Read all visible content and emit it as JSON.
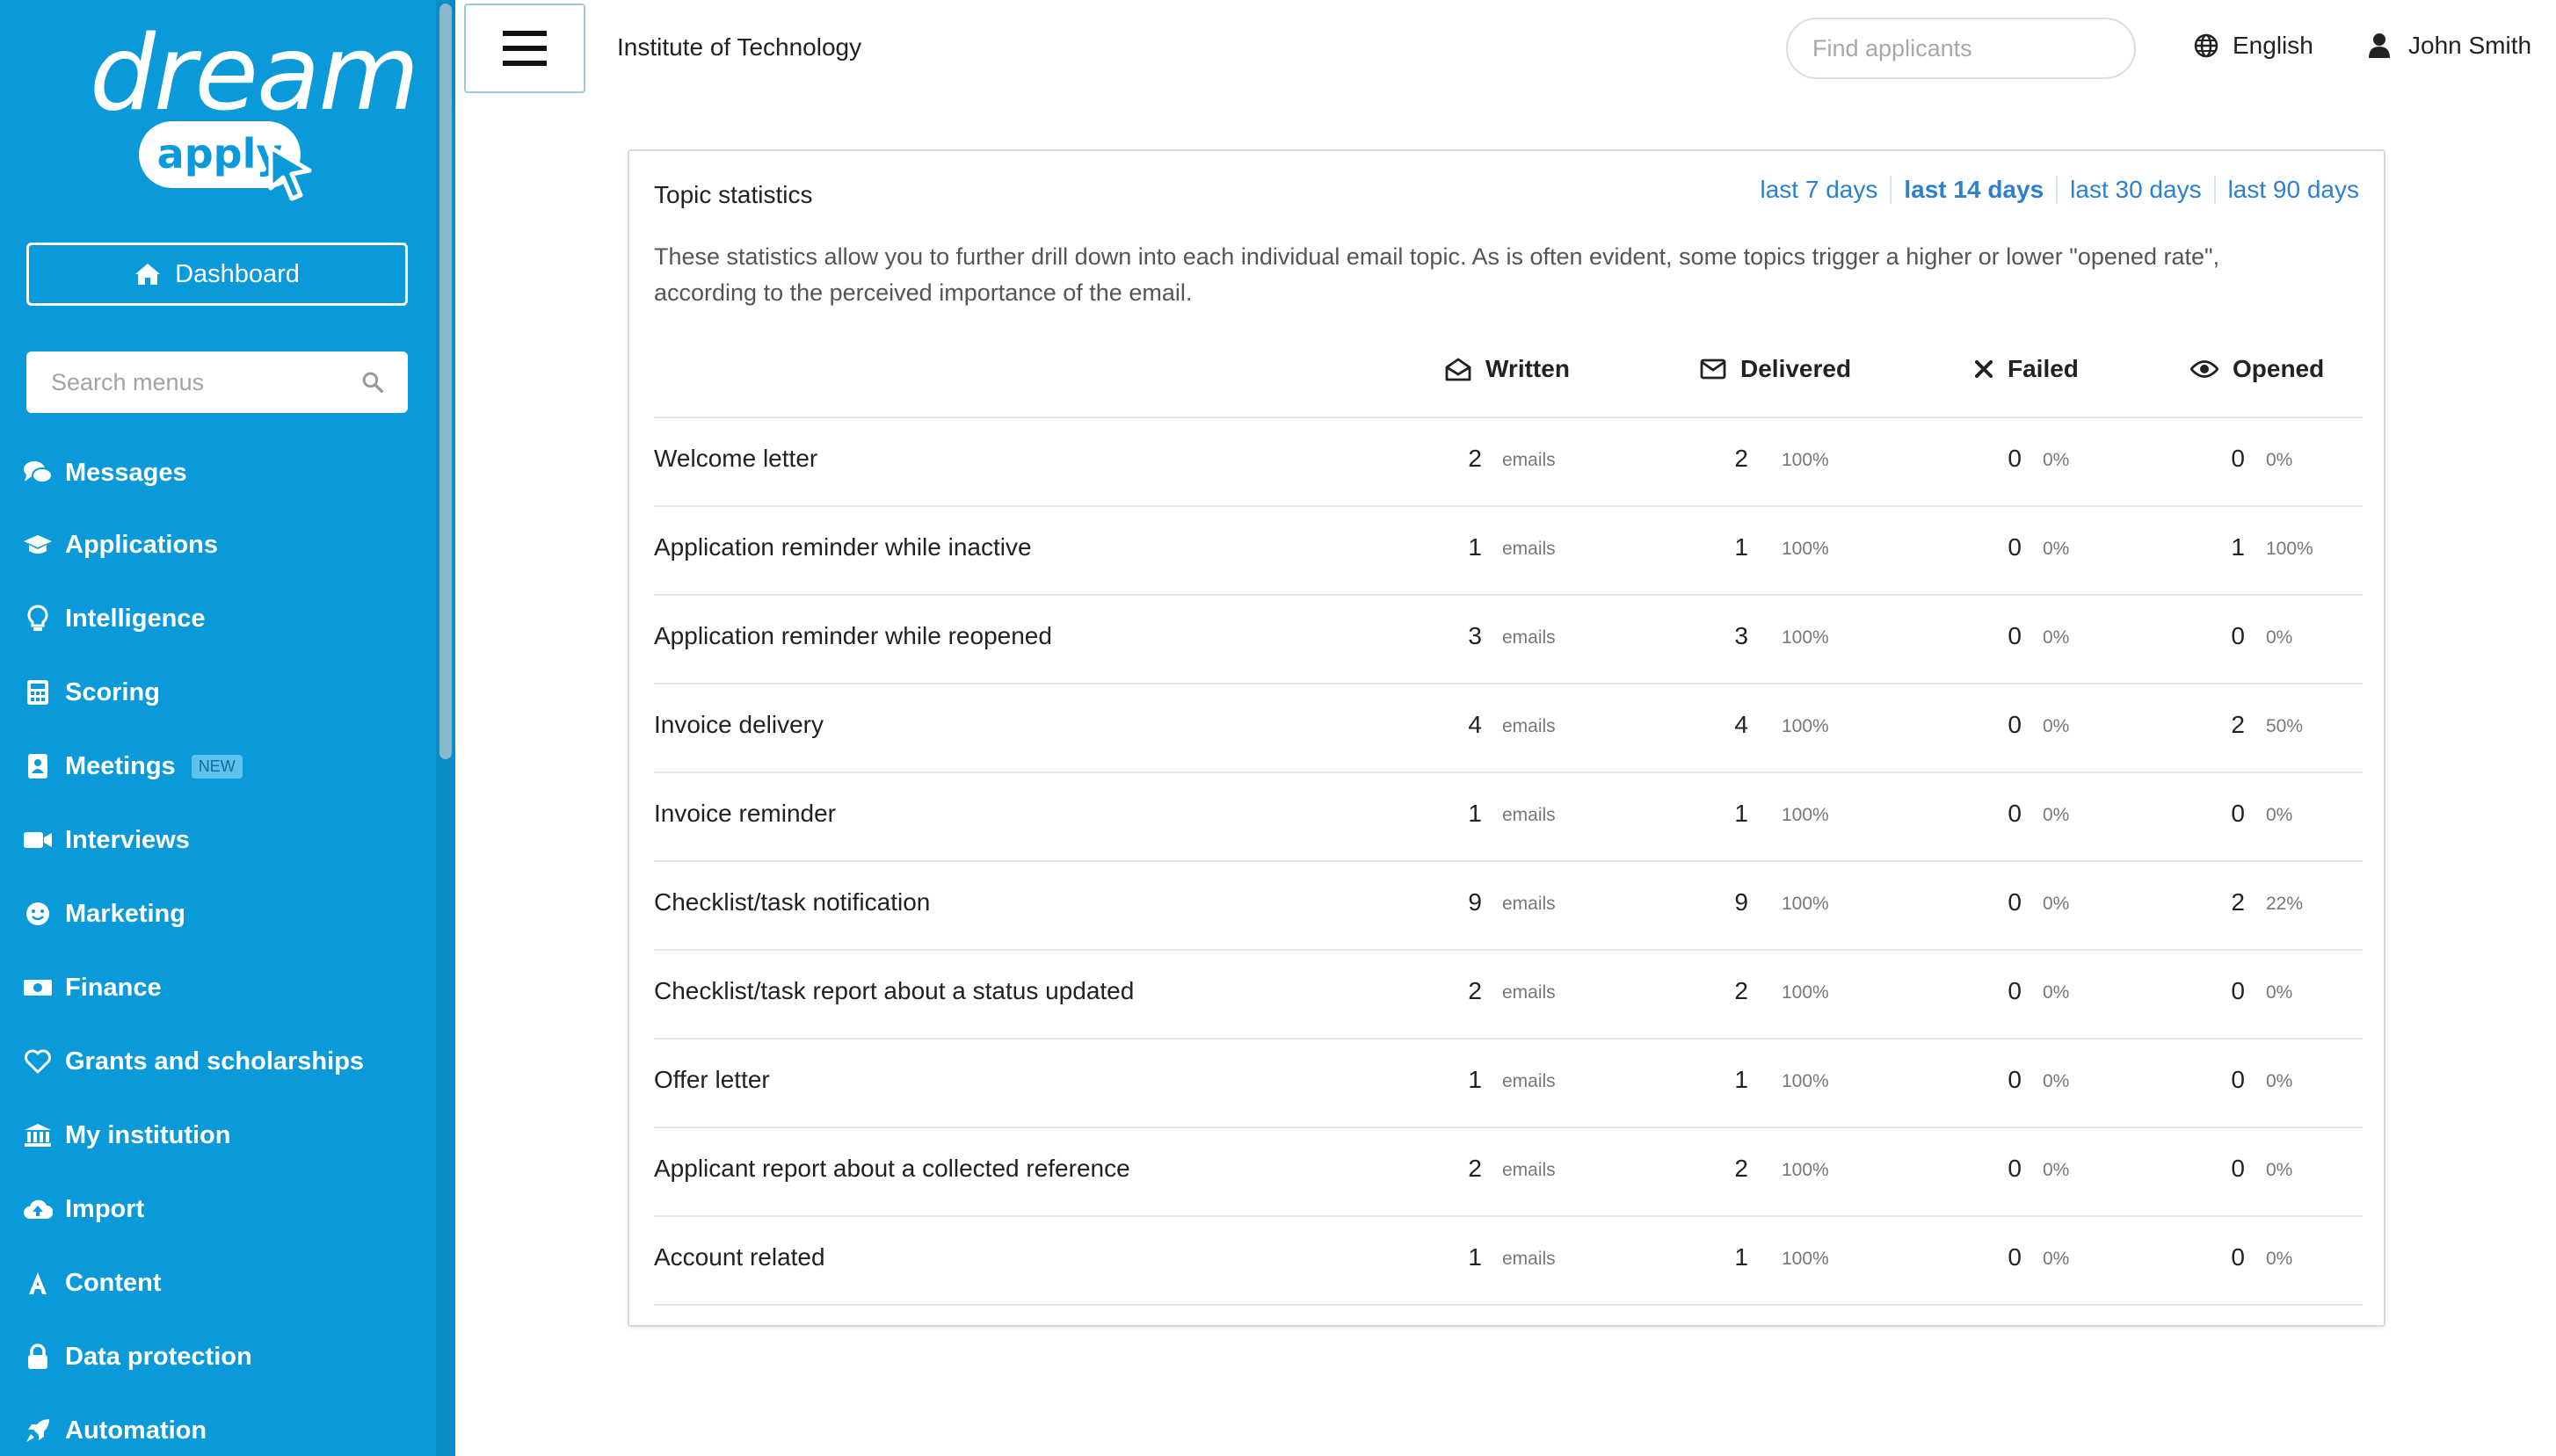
{
  "brand": {
    "logo_word": "dream",
    "logo_pill": "apply"
  },
  "sidebar": {
    "dashboard_label": "Dashboard",
    "search_placeholder": "Search menus",
    "items": [
      {
        "label": "Messages",
        "icon": "comments-icon"
      },
      {
        "label": "Applications",
        "icon": "graduation-cap-icon"
      },
      {
        "label": "Intelligence",
        "icon": "lightbulb-icon"
      },
      {
        "label": "Scoring",
        "icon": "calculator-icon"
      },
      {
        "label": "Meetings",
        "icon": "address-book-icon",
        "badge": "NEW"
      },
      {
        "label": "Interviews",
        "icon": "video-icon"
      },
      {
        "label": "Marketing",
        "icon": "smile-icon"
      },
      {
        "label": "Finance",
        "icon": "money-bill-icon"
      },
      {
        "label": "Grants and scholarships",
        "icon": "heart-icon"
      },
      {
        "label": "My institution",
        "icon": "university-icon"
      },
      {
        "label": "Import",
        "icon": "cloud-upload-icon"
      },
      {
        "label": "Content",
        "icon": "font-icon"
      },
      {
        "label": "Data protection",
        "icon": "lock-icon"
      },
      {
        "label": "Automation",
        "icon": "rocket-icon"
      }
    ]
  },
  "topbar": {
    "institution": "Institute of Technology",
    "search_placeholder": "Find applicants",
    "language": "English",
    "user_name": "John Smith"
  },
  "panel": {
    "title": "Topic statistics",
    "ranges": [
      "last 7 days",
      "last 14 days",
      "last 30 days",
      "last 90 days"
    ],
    "active_range": "last 14 days",
    "description": "These statistics allow you to further drill down into each individual email topic. As is often evident, some topics trigger a higher or lower \"opened rate\", according to the perceived importance of the email.",
    "columns": {
      "written": "Written",
      "delivered": "Delivered",
      "failed": "Failed",
      "opened": "Opened"
    },
    "unit_label": "emails",
    "rows": [
      {
        "topic": "Welcome letter",
        "written": "2",
        "delivered": "2",
        "delivered_pct": "100%",
        "failed": "0",
        "failed_pct": "0%",
        "opened": "0",
        "opened_pct": "0%"
      },
      {
        "topic": "Application reminder while inactive",
        "written": "1",
        "delivered": "1",
        "delivered_pct": "100%",
        "failed": "0",
        "failed_pct": "0%",
        "opened": "1",
        "opened_pct": "100%"
      },
      {
        "topic": "Application reminder while reopened",
        "written": "3",
        "delivered": "3",
        "delivered_pct": "100%",
        "failed": "0",
        "failed_pct": "0%",
        "opened": "0",
        "opened_pct": "0%"
      },
      {
        "topic": "Invoice delivery",
        "written": "4",
        "delivered": "4",
        "delivered_pct": "100%",
        "failed": "0",
        "failed_pct": "0%",
        "opened": "2",
        "opened_pct": "50%"
      },
      {
        "topic": "Invoice reminder",
        "written": "1",
        "delivered": "1",
        "delivered_pct": "100%",
        "failed": "0",
        "failed_pct": "0%",
        "opened": "0",
        "opened_pct": "0%"
      },
      {
        "topic": "Checklist/task notification",
        "written": "9",
        "delivered": "9",
        "delivered_pct": "100%",
        "failed": "0",
        "failed_pct": "0%",
        "opened": "2",
        "opened_pct": "22%"
      },
      {
        "topic": "Checklist/task report about a status updated",
        "written": "2",
        "delivered": "2",
        "delivered_pct": "100%",
        "failed": "0",
        "failed_pct": "0%",
        "opened": "0",
        "opened_pct": "0%"
      },
      {
        "topic": "Offer letter",
        "written": "1",
        "delivered": "1",
        "delivered_pct": "100%",
        "failed": "0",
        "failed_pct": "0%",
        "opened": "0",
        "opened_pct": "0%"
      },
      {
        "topic": "Applicant report about a collected reference",
        "written": "2",
        "delivered": "2",
        "delivered_pct": "100%",
        "failed": "0",
        "failed_pct": "0%",
        "opened": "0",
        "opened_pct": "0%"
      },
      {
        "topic": "Account related",
        "written": "1",
        "delivered": "1",
        "delivered_pct": "100%",
        "failed": "0",
        "failed_pct": "0%",
        "opened": "0",
        "opened_pct": "0%"
      }
    ]
  },
  "colors": {
    "sidebar": "#0b9ad9",
    "link": "#2d7fcf"
  }
}
